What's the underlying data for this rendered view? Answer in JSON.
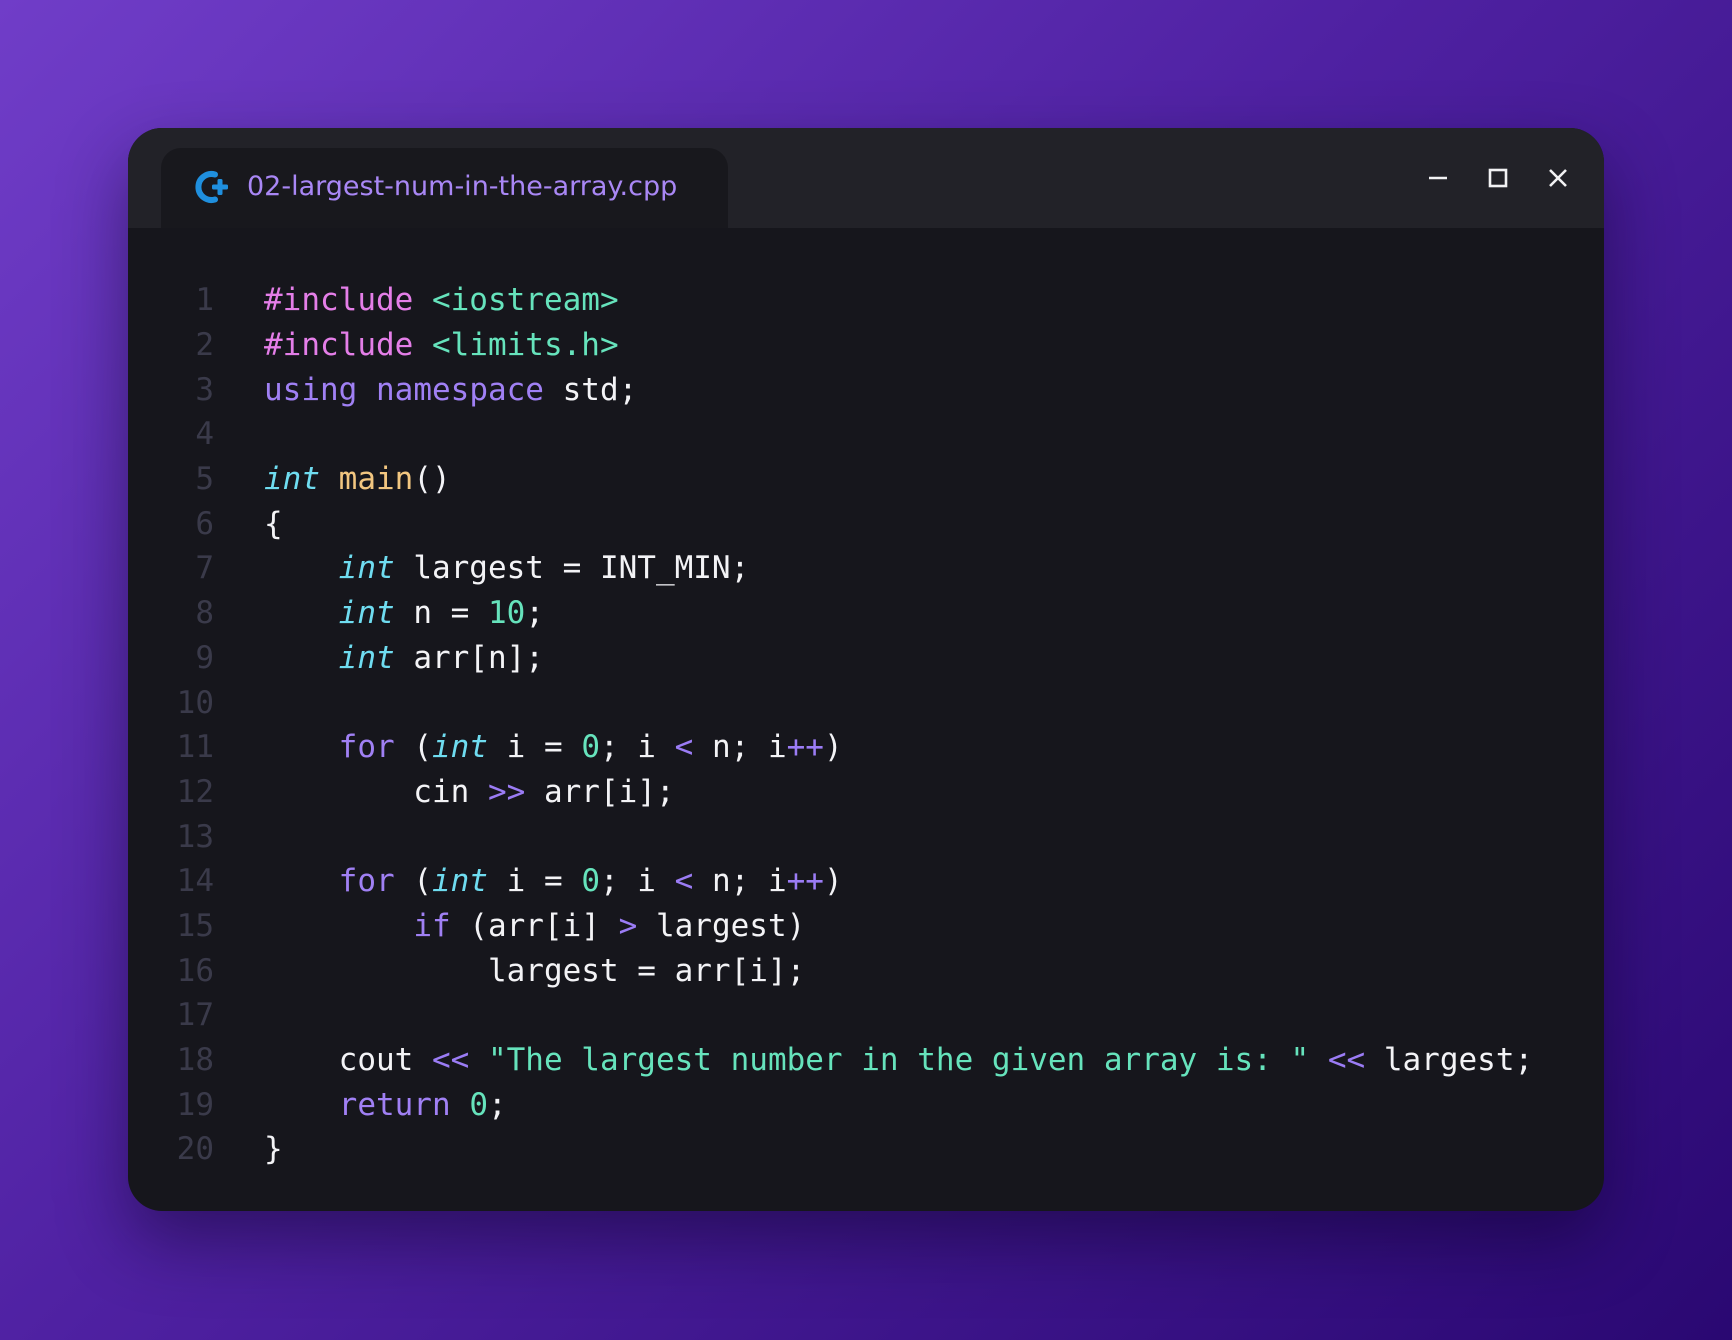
{
  "window": {
    "tab_title": "02-largest-num-in-the-array.cpp",
    "tab_icon": "cpp-icon",
    "controls": {
      "minimize_icon": "minimize-icon",
      "maximize_icon": "maximize-icon",
      "close_icon": "close-icon"
    }
  },
  "colors": {
    "background_start": "#703dc8",
    "background_end": "#2a0872",
    "window_bg": "#16161c",
    "titlebar_bg": "#222228",
    "tab_title": "#a987f5",
    "line_number": "#3a3a4a",
    "text": "#f3f3f6",
    "preprocessor": "#e47ee8",
    "keyword": "#a080f4",
    "type": "#6fdcf0",
    "function": "#f2c680",
    "literal": "#66e3bc"
  },
  "code": [
    {
      "n": "1",
      "t": [
        [
          "pp",
          "#include"
        ],
        [
          "",
          " "
        ],
        [
          "hdr",
          "<iostream>"
        ]
      ]
    },
    {
      "n": "2",
      "t": [
        [
          "pp",
          "#include"
        ],
        [
          "",
          " "
        ],
        [
          "hdr",
          "<limits.h>"
        ]
      ]
    },
    {
      "n": "3",
      "t": [
        [
          "kw",
          "using"
        ],
        [
          "",
          " "
        ],
        [
          "kw",
          "namespace"
        ],
        [
          "",
          " std;"
        ]
      ]
    },
    {
      "n": "4",
      "t": []
    },
    {
      "n": "5",
      "t": [
        [
          "ty",
          "int"
        ],
        [
          "",
          " "
        ],
        [
          "fn",
          "main"
        ],
        [
          "",
          "()"
        ]
      ]
    },
    {
      "n": "6",
      "t": [
        [
          "",
          "{"
        ]
      ]
    },
    {
      "n": "7",
      "t": [
        [
          "",
          "    "
        ],
        [
          "ty",
          "int"
        ],
        [
          "",
          " largest = INT_MIN;"
        ]
      ]
    },
    {
      "n": "8",
      "t": [
        [
          "",
          "    "
        ],
        [
          "ty",
          "int"
        ],
        [
          "",
          " n = "
        ],
        [
          "num",
          "10"
        ],
        [
          "",
          ";"
        ]
      ]
    },
    {
      "n": "9",
      "t": [
        [
          "",
          "    "
        ],
        [
          "ty",
          "int"
        ],
        [
          "",
          " arr[n];"
        ]
      ]
    },
    {
      "n": "10",
      "t": []
    },
    {
      "n": "11",
      "t": [
        [
          "",
          "    "
        ],
        [
          "kw",
          "for"
        ],
        [
          "",
          " ("
        ],
        [
          "ty",
          "int"
        ],
        [
          "",
          " i = "
        ],
        [
          "num",
          "0"
        ],
        [
          "",
          "; i "
        ],
        [
          "op",
          "<"
        ],
        [
          "",
          " n; i"
        ],
        [
          "op",
          "++"
        ],
        [
          "",
          ")"
        ]
      ]
    },
    {
      "n": "12",
      "t": [
        [
          "",
          "        cin "
        ],
        [
          "op",
          ">>"
        ],
        [
          "",
          " arr[i];"
        ]
      ]
    },
    {
      "n": "13",
      "t": []
    },
    {
      "n": "14",
      "t": [
        [
          "",
          "    "
        ],
        [
          "kw",
          "for"
        ],
        [
          "",
          " ("
        ],
        [
          "ty",
          "int"
        ],
        [
          "",
          " i = "
        ],
        [
          "num",
          "0"
        ],
        [
          "",
          "; i "
        ],
        [
          "op",
          "<"
        ],
        [
          "",
          " n; i"
        ],
        [
          "op",
          "++"
        ],
        [
          "",
          ")"
        ]
      ]
    },
    {
      "n": "15",
      "t": [
        [
          "",
          "        "
        ],
        [
          "kw",
          "if"
        ],
        [
          "",
          " (arr[i] "
        ],
        [
          "op",
          ">"
        ],
        [
          "",
          " largest)"
        ]
      ]
    },
    {
      "n": "16",
      "t": [
        [
          "",
          "            largest = arr[i];"
        ]
      ]
    },
    {
      "n": "17",
      "t": []
    },
    {
      "n": "18",
      "t": [
        [
          "",
          "    cout "
        ],
        [
          "op",
          "<<"
        ],
        [
          "",
          " "
        ],
        [
          "str",
          "\"The largest number in the given array is: \""
        ],
        [
          "",
          " "
        ],
        [
          "op",
          "<<"
        ],
        [
          "",
          " largest;"
        ]
      ]
    },
    {
      "n": "19",
      "t": [
        [
          "",
          "    "
        ],
        [
          "kw",
          "return"
        ],
        [
          "",
          " "
        ],
        [
          "num",
          "0"
        ],
        [
          "",
          ";"
        ]
      ]
    },
    {
      "n": "20",
      "t": [
        [
          "",
          "}"
        ]
      ]
    }
  ]
}
